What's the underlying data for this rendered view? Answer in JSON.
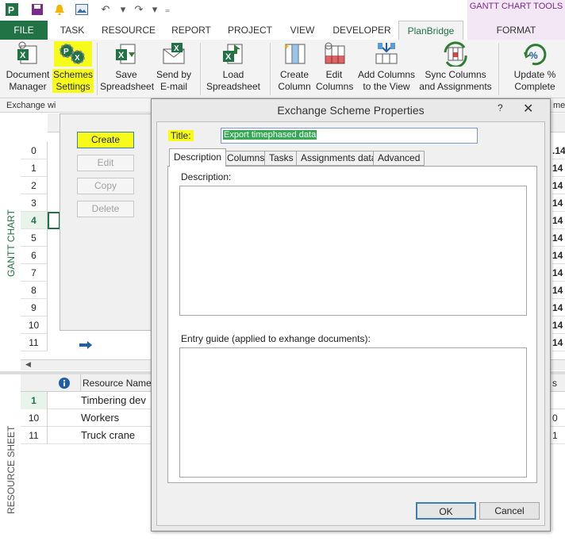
{
  "ribbon_tabs": {
    "file": "FILE",
    "task": "TASK",
    "resource": "RESOURCE",
    "report": "REPORT",
    "project": "PROJECT",
    "view": "VIEW",
    "developer": "DEVELOPER",
    "planbridge": "PlanBridge",
    "contextual_title": "GANTT CHART TOOLS",
    "format": "FORMAT"
  },
  "ribbon_buttons": {
    "doc_manager": [
      "Document",
      "Manager"
    ],
    "schemes": [
      "Schemes",
      "Settings"
    ],
    "save_spreadsheet": [
      "Save",
      "Spreadsheet"
    ],
    "send_email": [
      "Send by",
      "E-mail"
    ],
    "load_spreadsheet": [
      "Load",
      "Spreadsheet"
    ],
    "create_column": [
      "Create",
      "Column"
    ],
    "edit_columns": [
      "Edit",
      "Columns"
    ],
    "add_columns": [
      "Add Columns",
      "to the View"
    ],
    "sync_columns": [
      "Sync Columns",
      "and Assignments"
    ],
    "update_complete": [
      "Update %",
      "Complete"
    ]
  },
  "group_label": "Exchange wi",
  "group_label_right": "me",
  "side_labels": {
    "gantt": "GANTT CHART",
    "resource": "RESOURCE SHEET"
  },
  "gantt_rows": [
    "0",
    "1",
    "2",
    "3",
    "4",
    "5",
    "6",
    "7",
    "8",
    "9",
    "10",
    "11"
  ],
  "gantt_right_values": [
    ".14",
    "14",
    "14",
    "14",
    "14",
    "14",
    "14",
    "14",
    "14",
    "14",
    "14",
    "14"
  ],
  "bg_dialog_buttons": {
    "create": "Create",
    "edit": "Edit",
    "copy": "Copy",
    "delete": "Delete"
  },
  "resource_sheet": {
    "header_name": "Resource Name",
    "header_right": "s",
    "rows": [
      {
        "num": "1",
        "name": "Timbering dev",
        "right": ""
      },
      {
        "num": "10",
        "name": "Workers",
        "right": "0"
      },
      {
        "num": "11",
        "name": "Truck crane",
        "right": "1"
      }
    ]
  },
  "dialog": {
    "title": "Exchange Scheme Properties",
    "help": "?",
    "close": "✕",
    "title_label": "Title:",
    "title_value": "Export timephased data",
    "tabs": [
      "Description",
      "Columns",
      "Tasks",
      "Assignments data",
      "Advanced"
    ],
    "description_label": "Description:",
    "entry_guide_label": "Entry guide (applied to exhange documents):",
    "ok": "OK",
    "cancel": "Cancel"
  },
  "colors": {
    "file_tab": "#217346",
    "highlight": "#f6fb1a",
    "contextual_bg": "#f3e7f5",
    "selection": "#34a853"
  }
}
